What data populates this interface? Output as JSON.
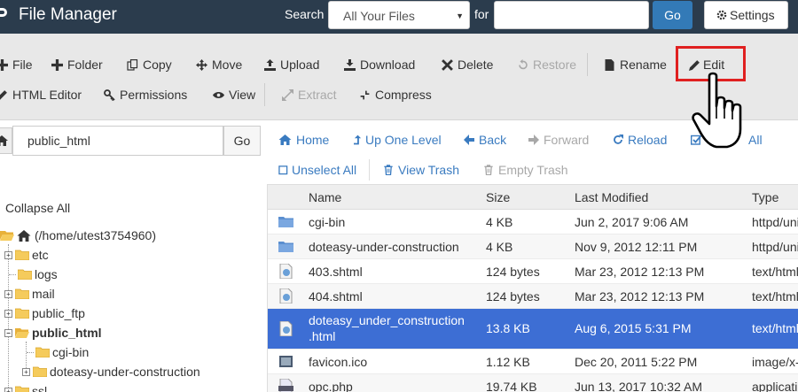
{
  "header": {
    "brand": "File Manager",
    "search_label": "Search",
    "search_scope": "All Your Files",
    "for_label": "for",
    "search_value": "",
    "go_label": "Go",
    "settings_label": "Settings"
  },
  "toolbar": {
    "file": "File",
    "folder": "Folder",
    "copy": "Copy",
    "move": "Move",
    "upload": "Upload",
    "download": "Download",
    "delete": "Delete",
    "restore": "Restore",
    "rename": "Rename",
    "edit": "Edit",
    "html_editor": "HTML Editor",
    "permissions": "Permissions",
    "view": "View",
    "extract": "Extract",
    "compress": "Compress"
  },
  "pathbar": {
    "path": "public_html",
    "go_label": "Go"
  },
  "nav": {
    "home": "Home",
    "up_one_level": "Up One Level",
    "back": "Back",
    "forward": "Forward",
    "reload": "Reload",
    "select_all": "All",
    "unselect_all": "Unselect All",
    "view_trash": "View Trash",
    "empty_trash": "Empty Trash"
  },
  "tree": {
    "collapse_all": "Collapse All",
    "root": "(/home/utest3754960)",
    "items": [
      "etc",
      "logs",
      "mail",
      "public_ftp",
      "public_html",
      "cgi-bin",
      "doteasy-under-construction",
      "ssl"
    ]
  },
  "table": {
    "columns": [
      "Name",
      "Size",
      "Last Modified",
      "Type"
    ],
    "rows": [
      {
        "name": "cgi-bin",
        "size": "4 KB",
        "modified": "Jun 2, 2017 9:06 AM",
        "type": "httpd/unix-directory",
        "icon": "folder-icon"
      },
      {
        "name": "doteasy-under-construction",
        "size": "4 KB",
        "modified": "Nov 9, 2012 12:11 PM",
        "type": "httpd/unix-directory",
        "icon": "folder-icon"
      },
      {
        "name": "403.shtml",
        "size": "124 bytes",
        "modified": "Mar 23, 2012 12:13 PM",
        "type": "text/html",
        "icon": "web-file-icon"
      },
      {
        "name": "404.shtml",
        "size": "124 bytes",
        "modified": "Mar 23, 2012 12:13 PM",
        "type": "text/html",
        "icon": "web-file-icon"
      },
      {
        "name_line1": "doteasy_under_construction",
        "name_line2": ".html",
        "size": "13.8 KB",
        "modified": "Aug 6, 2015 5:31 PM",
        "type": "text/html",
        "icon": "web-file-icon",
        "selected": true
      },
      {
        "name": "favicon.ico",
        "size": "1.12 KB",
        "modified": "Dec 20, 2011 5:22 PM",
        "type": "image/x-icon",
        "icon": "image-file-icon"
      },
      {
        "name": "opc.php",
        "size": "19.74 KB",
        "modified": "Jun 13, 2017 10:32 AM",
        "type": "application/x-httpd-php",
        "icon": "php-file-icon"
      }
    ]
  },
  "colors": {
    "header_bg": "#2b3c4d",
    "primary": "#337ab7",
    "selected_row": "#3d6ed4",
    "link": "#3a7bc0",
    "highlight": "#e02020"
  }
}
